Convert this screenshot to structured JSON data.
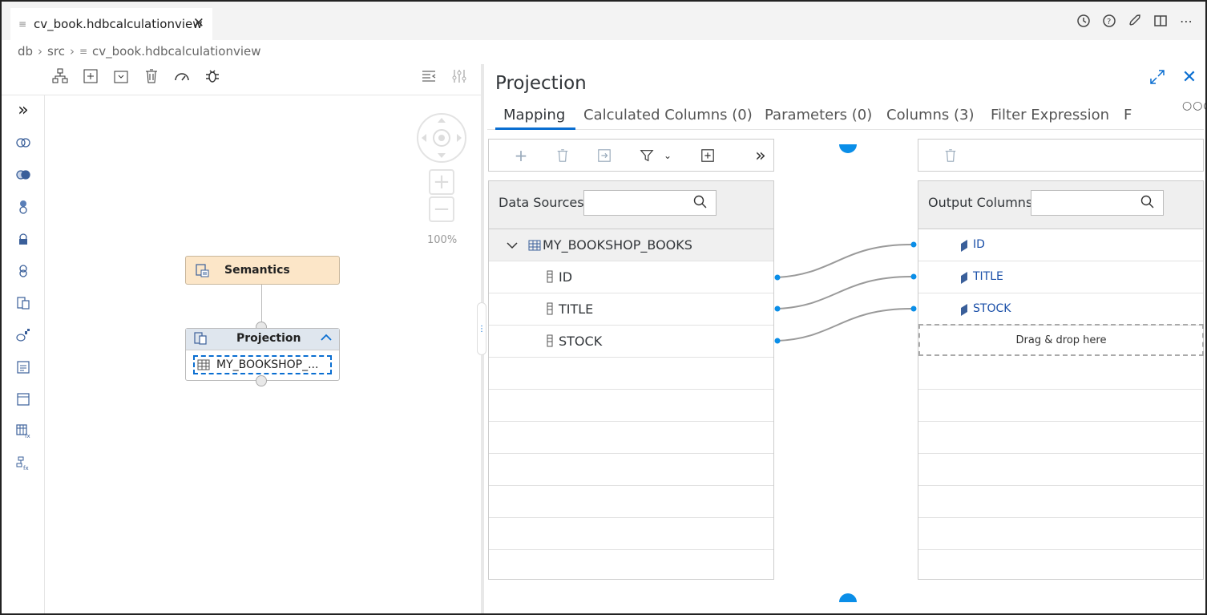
{
  "tab": {
    "label": "cv_book.hdbcalculationview"
  },
  "breadcrumb": {
    "part1": "db",
    "part2": "src",
    "part3": "cv_book.hdbcalculationview"
  },
  "canvas": {
    "zoom_level": "100%",
    "semantics_label": "Semantics",
    "projection_label": "Projection",
    "datasource_label": "MY_BOOKSHOP_..."
  },
  "panel": {
    "title": "Projection",
    "tabs": [
      "Mapping",
      "Calculated Columns (0)",
      "Parameters (0)",
      "Columns (3)",
      "Filter Expression",
      "F"
    ],
    "active_tab": "Mapping"
  },
  "data_sources": {
    "label": "Data Sources",
    "search_placeholder": "",
    "group": "MY_BOOKSHOP_BOOKS",
    "columns": [
      "ID",
      "TITLE",
      "STOCK"
    ]
  },
  "output_columns": {
    "label": "Output Columns",
    "search_placeholder": "",
    "columns": [
      "ID",
      "TITLE",
      "STOCK"
    ],
    "drop_hint": "Drag & drop here"
  },
  "colors": {
    "accent": "#0a6ed1",
    "semantics_bg": "#fce6c8",
    "link_line": "#9a9a9a"
  }
}
